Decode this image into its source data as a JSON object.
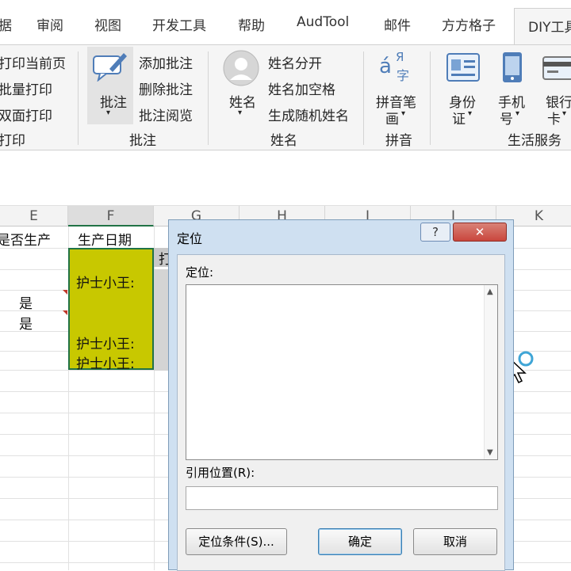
{
  "tabs": [
    "据",
    "审阅",
    "视图",
    "开发工具",
    "帮助",
    "AudTool",
    "邮件",
    "方方格子"
  ],
  "active_tab": "DIY工具",
  "ribbon": {
    "print": [
      "打印当前页",
      "批量打印",
      "双面打印",
      "打印"
    ],
    "comment_btn": "批注",
    "comment_items": [
      "添加批注",
      "删除批注",
      "批注阅览"
    ],
    "comment_group": "批注",
    "name_btn": "姓名",
    "name_items": [
      "姓名分开",
      "姓名加空格",
      "生成随机姓名"
    ],
    "name_group": "姓名",
    "pinyin_btn": [
      "拼音笔",
      "画"
    ],
    "pinyin_group": "拼音",
    "id_btn": [
      "身份",
      "证"
    ],
    "phone_btn": [
      "手机",
      "号"
    ],
    "bank_btn": [
      "银行",
      "卡"
    ],
    "life_group": "生活服务",
    "pinyin_glyph_a": "á",
    "pinyin_glyph_r": "Я",
    "pinyin_glyph_z": "字"
  },
  "columns": [
    "E",
    "F",
    "G",
    "H",
    "I",
    "J",
    "K"
  ],
  "cells": {
    "e_header": "是否生产",
    "f_header": "生产日期",
    "g_partial": "打",
    "e1": "是",
    "e2": "是",
    "f1": "护士小王:",
    "f2": "护士小王:",
    "f3": "护士小王:"
  },
  "dialog": {
    "title": "定位",
    "help": "?",
    "close": "✕",
    "goto_label": "定位:",
    "ref_label": "引用位置(R):",
    "ref_value": "",
    "special_button": "定位条件(S)...",
    "ok_button": "确定",
    "cancel_button": "取消"
  },
  "colors": {
    "selection_fill": "#c8c800",
    "selection_border": "#217346",
    "dialog_frame": "#cfe0f1",
    "close_red": "#c9463d"
  }
}
